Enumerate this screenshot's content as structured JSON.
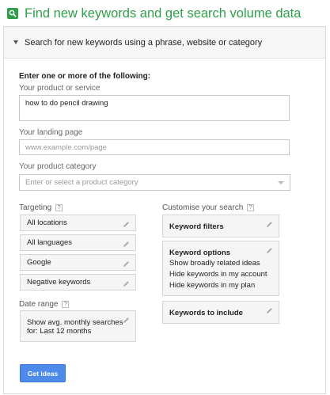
{
  "header": {
    "title": "Find new keywords and get search volume data",
    "icon": "search-icon",
    "accent": "#2e9f4a"
  },
  "panel": {
    "heading": "Search for new keywords using a phrase, website or category",
    "intro": "Enter one or more of the following:"
  },
  "product_service": {
    "label": "Your product or service",
    "value": "how to do pencil drawing"
  },
  "landing_page": {
    "label": "Your landing page",
    "placeholder": "www.example.com/page"
  },
  "product_category": {
    "label": "Your product category",
    "placeholder": "Enter or select a product category"
  },
  "targeting": {
    "label": "Targeting",
    "help": "?",
    "items": [
      "All locations",
      "All languages",
      "Google",
      "Negative keywords"
    ]
  },
  "date_range": {
    "label": "Date range",
    "help": "?",
    "line1": "Show avg. monthly searches",
    "line2": "for: Last 12 months"
  },
  "customise": {
    "label": "Customise your search",
    "help": "?",
    "keyword_filters": "Keyword filters",
    "keyword_options": {
      "title": "Keyword options",
      "lines": [
        "Show broadly related ideas",
        "Hide keywords in my account",
        "Hide keywords in my plan"
      ]
    },
    "keywords_to_include": "Keywords to include"
  },
  "button": {
    "label": "Get ideas",
    "color": "#4d8ae9"
  }
}
